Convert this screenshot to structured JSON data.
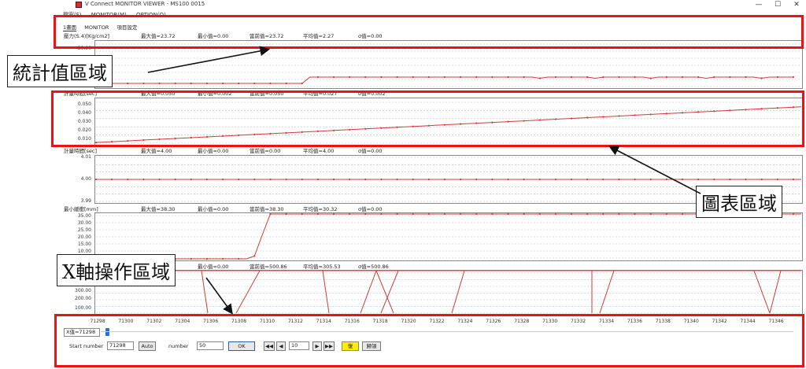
{
  "window": {
    "title": "V Connect MONITOR VIEWER - MS100 0015",
    "minimize_glyph": "—",
    "maximize_glyph": "☐",
    "close_glyph": "✕"
  },
  "menubar": {
    "items": [
      "檔案(F)",
      "MONITOR(M)",
      "OPTION(O)"
    ]
  },
  "tabs": {
    "items": [
      "1畫面",
      "MONITOR",
      "項目設定"
    ]
  },
  "charts": [
    {
      "name": "壓力(S.4)[Kg/cm2]",
      "max": "最大值=23.72",
      "min": "最小值=0.00",
      "cur": "當前值=23.72",
      "avg": "平均值=2.27",
      "std": "σ值=0.00",
      "ticks": [
        "20.00"
      ]
    },
    {
      "name": "計量時間[sec]",
      "max": "最大值=0.050",
      "min": "最小值=0.002",
      "cur": "當前值=0.050",
      "avg": "平均值=0.027",
      "std": "σ值=0.002",
      "ticks": [
        "0.050",
        "0.040",
        "0.030",
        "0.020",
        "0.010"
      ]
    },
    {
      "name": "計量時間[sec]",
      "max": "最大值=4.00",
      "min": "最小值=0.00",
      "cur": "當前值=0.00",
      "avg": "平均值=4.00",
      "std": "σ值=0.00",
      "ticks": [
        "4.01",
        "4.00",
        "3.99"
      ]
    },
    {
      "name": "最小緩衝[mm]",
      "max": "最大值=38.30",
      "min": "最小值=0.00",
      "cur": "當前值=38.30",
      "avg": "平均值=30.32",
      "std": "σ值=0.00",
      "ticks": [
        "35.00",
        "30.00",
        "25.00",
        "20.00",
        "15.00",
        "10.00"
      ]
    },
    {
      "name": "",
      "max": "",
      "min": "最小值=0.00",
      "cur": "當前值=500.86",
      "avg": "平均值=305.53",
      "std": "σ值=500.86",
      "ticks": [
        "300.00",
        "200.00",
        "100.00"
      ]
    }
  ],
  "x_axis": {
    "ticks": [
      "71298",
      "71300",
      "71302",
      "71304",
      "71306",
      "71308",
      "71310",
      "71312",
      "71314",
      "71316",
      "71318",
      "71320",
      "71322",
      "71324",
      "71326",
      "71328",
      "71330",
      "71332",
      "71334",
      "71336",
      "71338",
      "71340",
      "71342",
      "71344",
      "71346"
    ]
  },
  "chart_data": [
    {
      "type": "line",
      "title": "",
      "xlabel": "",
      "ylabel": "壓力(S.4)[Kg/cm2]",
      "x_range": [
        71298,
        71347
      ],
      "series": [
        {
          "values": [
            0,
            0,
            0,
            0,
            0,
            0,
            0,
            0,
            0,
            0,
            0,
            0,
            0,
            0,
            0,
            0,
            0,
            0,
            0,
            0,
            0,
            0,
            0,
            0,
            0,
            0,
            0,
            23.7,
            23.7,
            23.7,
            23.7,
            23.7,
            23.7,
            23.7,
            23.7,
            23.7,
            23.7,
            23.7,
            23.7,
            23.7,
            23.7,
            23.7,
            23.7,
            23.7,
            23.7,
            23.7,
            23.7,
            23.7,
            23.7,
            23.7,
            23.7,
            23.7,
            23.7,
            23.7,
            23.7,
            23.7,
            23.7,
            23.7,
            23.7,
            23.7,
            23.7,
            23.7,
            23.7,
            23.7,
            23.7,
            23.7,
            23.7,
            23.7,
            23.7,
            23.7,
            23.7,
            23.7,
            23.7,
            23.7,
            23.7,
            23.7,
            23.7,
            23.7,
            23.7,
            23.7,
            23.7,
            23.7,
            23.7,
            23.7,
            23.7,
            23.7,
            23.7,
            23.7,
            23.7
          ]
        }
      ]
    },
    {
      "type": "line",
      "title": "",
      "xlabel": "",
      "ylabel": "計量時間[sec]",
      "ylim": [
        0,
        0.055
      ],
      "x_range": [
        71298,
        71347
      ],
      "series": [
        {
          "values": [
            0.002,
            0.05
          ]
        }
      ]
    },
    {
      "type": "line",
      "title": "",
      "xlabel": "",
      "ylabel": "計量時間[sec]",
      "ylim": [
        3.99,
        4.01
      ],
      "series": [
        {
          "values": [
            4.0,
            4.0
          ]
        }
      ]
    },
    {
      "type": "line",
      "title": "",
      "xlabel": "",
      "ylabel": "最小緩衝[mm]",
      "ylim": [
        10,
        38
      ],
      "series": [
        {
          "values": [
            0,
            0,
            38.3,
            38.3
          ]
        }
      ]
    },
    {
      "type": "line",
      "title": "",
      "xlabel": "",
      "ylabel": "",
      "ylim": [
        100,
        300
      ],
      "series": [
        {
          "values": [
            300,
            90,
            90,
            300
          ]
        }
      ]
    }
  ],
  "cursor": {
    "label": "X值=71298"
  },
  "controls": {
    "start_label": "Start number",
    "start_value": "71298",
    "auto_label": "Auto",
    "number_label": "number",
    "number_value": "50",
    "ok_label": "OK",
    "first_glyph": "◀◀",
    "prev_glyph": "◀",
    "step_value": "10",
    "next_glyph": "▶",
    "last_glyph": "▶▶",
    "yellow_label": "復",
    "reset_label": "歸領"
  },
  "callouts": {
    "stats": "統計值區域",
    "chart": "圖表區域",
    "xaxis": "X軸操作區域"
  },
  "colors": {
    "highlight": "#ee1111",
    "series": "#d03a3a",
    "grid": "#bbbbbb"
  }
}
